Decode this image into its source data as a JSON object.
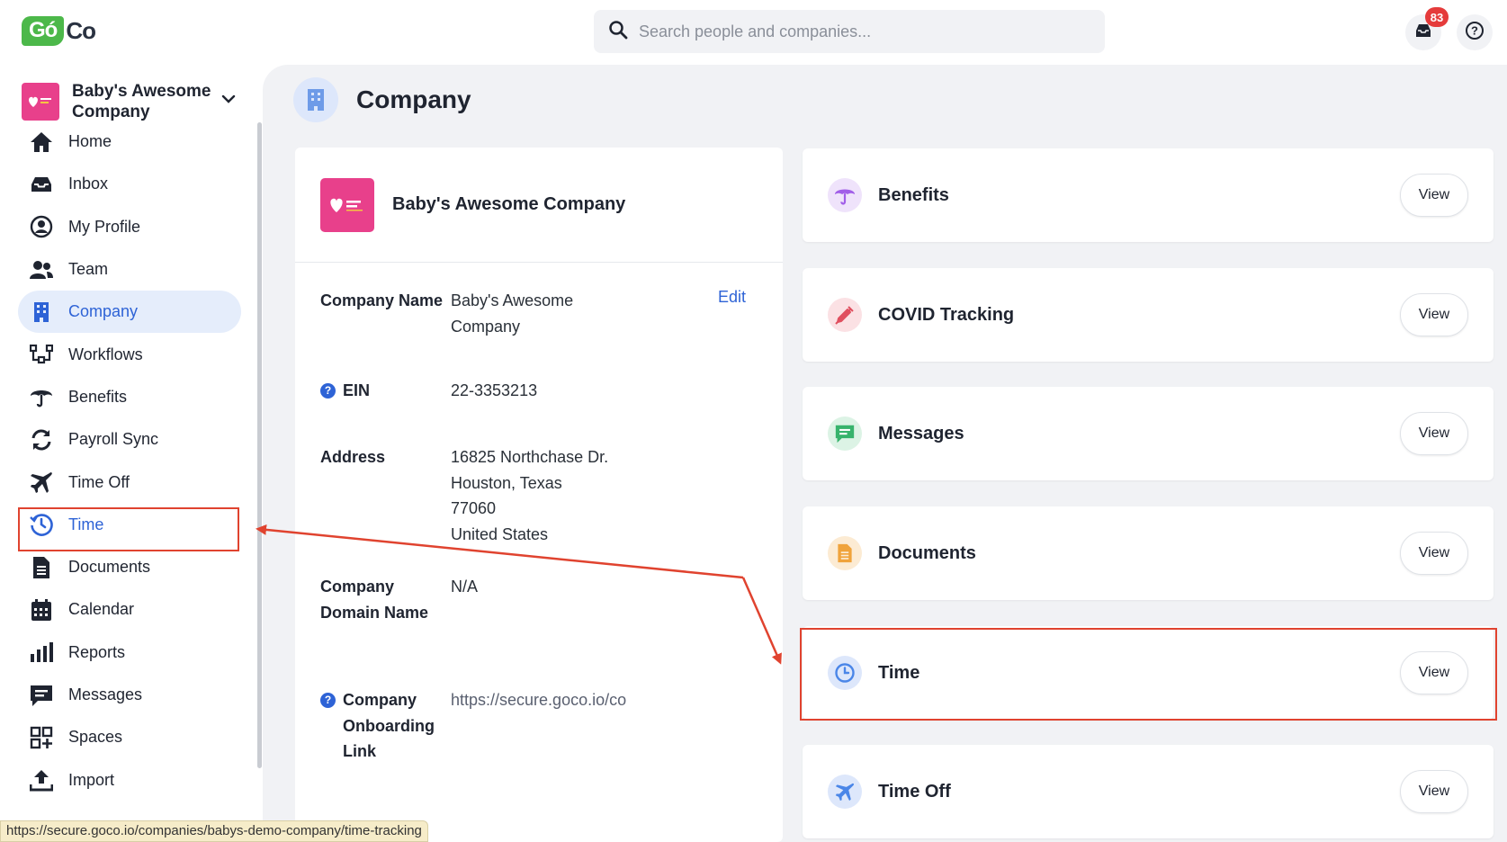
{
  "app": {
    "logo_go": "Gó",
    "logo_co": "Co"
  },
  "search": {
    "placeholder": "Search people and companies..."
  },
  "header": {
    "notification_count": "83"
  },
  "sidebar": {
    "company": "Baby's Awesome Company",
    "items": [
      {
        "label": "Home",
        "icon": "home-icon"
      },
      {
        "label": "Inbox",
        "icon": "inbox-icon"
      },
      {
        "label": "My Profile",
        "icon": "profile-icon"
      },
      {
        "label": "Team",
        "icon": "team-icon"
      },
      {
        "label": "Company",
        "icon": "building-icon"
      },
      {
        "label": "Workflows",
        "icon": "workflows-icon"
      },
      {
        "label": "Benefits",
        "icon": "umbrella-icon"
      },
      {
        "label": "Payroll Sync",
        "icon": "sync-icon"
      },
      {
        "label": "Time Off",
        "icon": "plane-icon"
      },
      {
        "label": "Time",
        "icon": "clock-icon"
      },
      {
        "label": "Documents",
        "icon": "document-icon"
      },
      {
        "label": "Calendar",
        "icon": "calendar-icon"
      },
      {
        "label": "Reports",
        "icon": "reports-icon"
      },
      {
        "label": "Messages",
        "icon": "message-icon"
      },
      {
        "label": "Spaces",
        "icon": "spaces-icon"
      },
      {
        "label": "Import",
        "icon": "import-icon"
      }
    ],
    "active": "Company"
  },
  "status_bar": {
    "url": "https://secure.goco.io/companies/babys-demo-company/time-tracking"
  },
  "page": {
    "title": "Company",
    "company_card": {
      "name": "Baby's Awesome Company",
      "fields": [
        {
          "label": "Company Name",
          "value": "Baby's Awesome Company"
        },
        {
          "label": "EIN",
          "value": "22-3353213"
        },
        {
          "label": "Address",
          "value": "16825 Northchase Dr.\nHouston, Texas\n77060\nUnited States"
        },
        {
          "label": "Company Domain Name",
          "value": "N/A"
        },
        {
          "label": "Company Onboarding Link",
          "value": "https://secure.goco.io/co"
        }
      ],
      "edit_label": "Edit"
    },
    "modules": [
      {
        "title": "Benefits",
        "button": "View",
        "icon": "umbrella-icon",
        "color": "#a15ee8"
      },
      {
        "title": "COVID Tracking",
        "button": "View",
        "icon": "syringe-icon",
        "color": "#e04f5f"
      },
      {
        "title": "Messages",
        "button": "View",
        "icon": "message-icon",
        "color": "#37b36c"
      },
      {
        "title": "Documents",
        "button": "View",
        "icon": "document-icon",
        "color": "#f0a33b"
      },
      {
        "title": "Time",
        "button": "View",
        "icon": "clock-icon",
        "color": "#4a86e8"
      },
      {
        "title": "Time Off",
        "button": "View",
        "icon": "plane-icon",
        "color": "#4a86e8"
      }
    ]
  },
  "colors": {
    "accent": "#2e63d6",
    "annotation": "#e0432f",
    "brand_green": "#4cb84a"
  }
}
